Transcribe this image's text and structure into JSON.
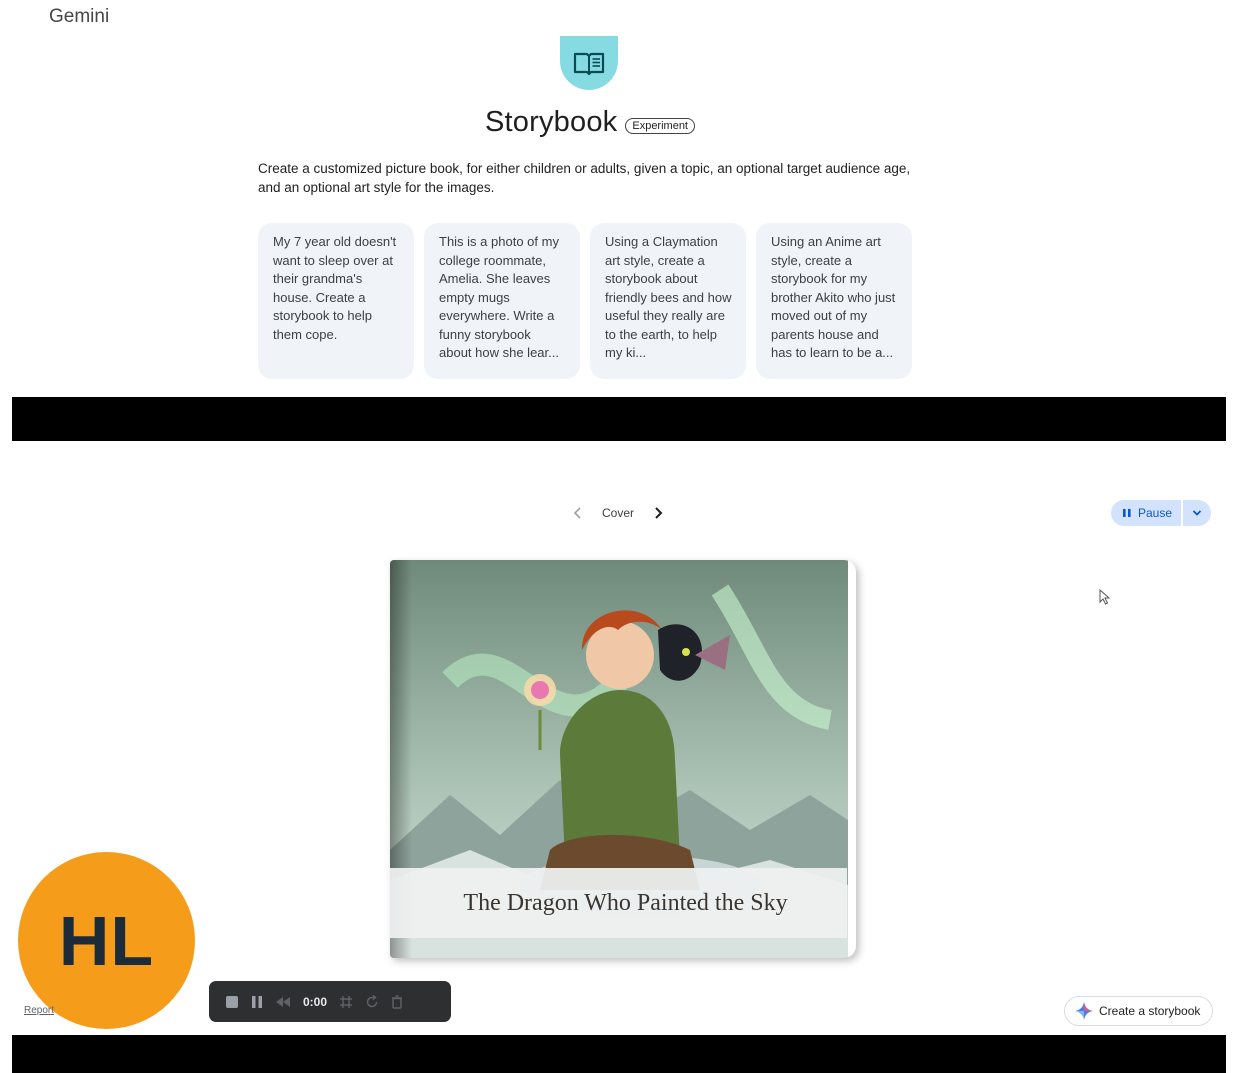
{
  "app": {
    "brand": "Gemini"
  },
  "gem": {
    "title": "Storybook",
    "badge": "Experiment",
    "description": "Create a customized picture book, for either children or adults, given a topic, an optional target audience age, and an optional art style for the images.",
    "icon": "open-book-icon"
  },
  "prompts": [
    {
      "text": "My 7 year old doesn't want to sleep over at their grandma's house. Create a storybook to help them cope."
    },
    {
      "text": "This is a photo of my college roommate, Amelia. She leaves empty mugs everywhere. Write a funny storybook about how she lear..."
    },
    {
      "text": "Using a Claymation art style, create a storybook about friendly bees and how useful they really are to the earth, to help my ki..."
    },
    {
      "text": "Using an Anime art style, create a storybook for my brother Akito who just moved out of my parents house and has to learn to be a..."
    }
  ],
  "viewer": {
    "page_label": "Cover",
    "pause_label": "Pause",
    "book_title": "The Dragon Who Painted the Sky"
  },
  "overlay": {
    "avatar_initials": "HL",
    "report_label": "Report",
    "recorder_time": "0:00"
  },
  "actions": {
    "create_label": "Create a storybook"
  },
  "colors": {
    "accent": "#0b57d0",
    "accent_bg": "#d3e3fd",
    "gem_icon_bg": "#86dbe3",
    "avatar_bg": "#f59d1a",
    "card_bg": "#f0f4f9"
  }
}
